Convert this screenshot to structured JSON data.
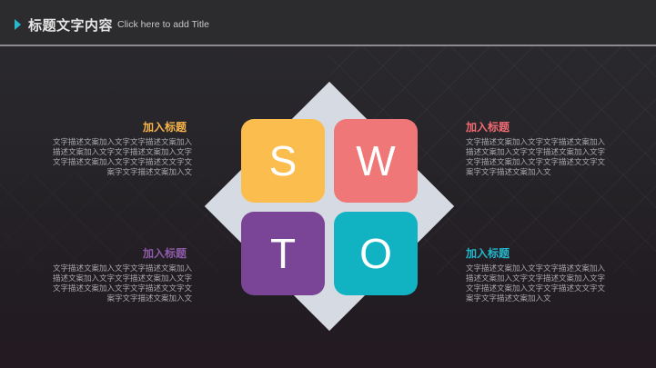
{
  "header": {
    "title": "标题文字内容",
    "subtitle": "Click here to add Title"
  },
  "swot": {
    "s": "S",
    "w": "W",
    "t": "T",
    "o": "O"
  },
  "blocks": {
    "top_left": {
      "title": "加入标题",
      "lines": [
        "文字描述文案加入文字文字描述文案加入",
        "描述文案加入文字文字描述文案加入文字",
        "文字描述文案加入文字文字描述文文字文",
        "案字文字描述文案加入文"
      ]
    },
    "top_right": {
      "title": "加入标题",
      "lines": [
        "文字描述文案加入文字文字描述文案加入",
        "描述文案加入文字文字描述文案加入文字",
        "文字描述文案加入文字文字描述文文字文",
        "案字文字描述文案加入文"
      ]
    },
    "bottom_left": {
      "title": "加入标题",
      "lines": [
        "文字描述文案加入文字文字描述文案加入",
        "描述文案加入文字文字描述文案加入文字",
        "文字描述文案加入文字文字描述文文字文",
        "案字文字描述文案加入文"
      ]
    },
    "bottom_right": {
      "title": "加入标题",
      "lines": [
        "文字描述文案加入文字文字描述文案加入",
        "描述文案加入文字文字描述文案加入文字",
        "文字描述文案加入文字文字描述文文字文",
        "案字文字描述文案加入文"
      ]
    }
  },
  "colors": {
    "s": "#fbbd4e",
    "w": "#ef7777",
    "t": "#7a4596",
    "o": "#11b3c3",
    "accent": "#28b9cf",
    "title_orange": "#f6b44a",
    "title_red": "#f06a72",
    "title_purple": "#8d5ba9",
    "title_cyan": "#22b7cb"
  }
}
